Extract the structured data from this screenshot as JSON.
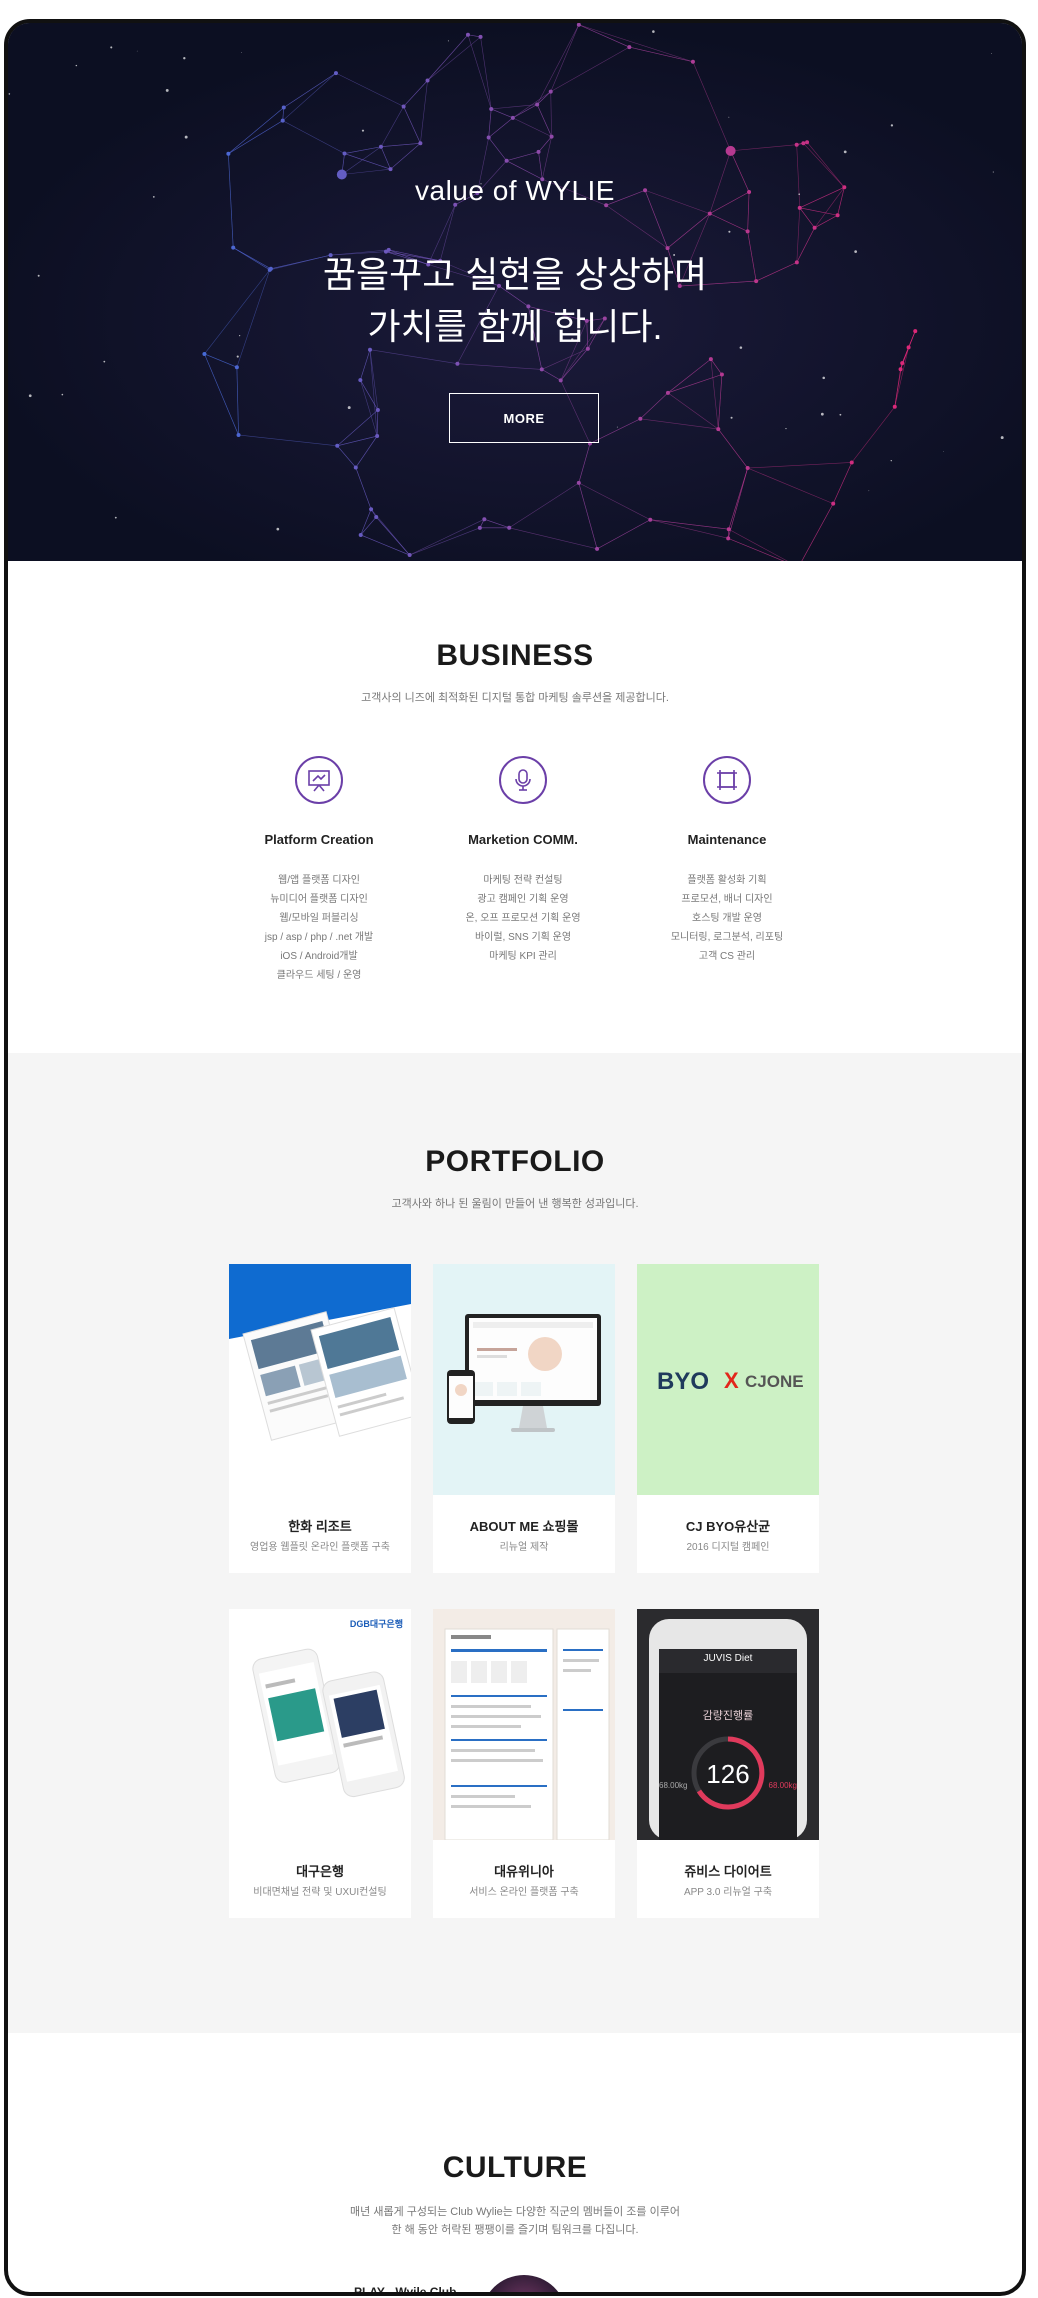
{
  "hero": {
    "tagline": "value of WYLIE",
    "headline_line1": "꿈을꾸고 실현을 상상하며",
    "headline_line2": "가치를 함께 합니다.",
    "more_label": "MORE"
  },
  "business": {
    "title": "BUSINESS",
    "subtitle": "고객사의 니즈에 최적화된 디지털 통합 마케팅 솔루션을 제공합니다.",
    "columns": [
      {
        "icon": "presentation-board-icon",
        "name": "Platform Creation",
        "items": [
          "웹/앱 플랫폼 디자인",
          "뉴미디어 플랫폼 디자인",
          "웹/모바일 퍼블리싱",
          "jsp / asp / php / .net 개발",
          "iOS / Android개발",
          "클라우드 세팅 / 운영"
        ]
      },
      {
        "icon": "microphone-icon",
        "name": "Marketion COMM.",
        "items": [
          "마케팅 전략 컨설팅",
          "광고 캠페인 기획 운영",
          "온, 오프 프로모션 기획 운영",
          "바이럴, SNS 기획 운영",
          "마케팅 KPI 관리"
        ]
      },
      {
        "icon": "frame-grid-icon",
        "name": "Maintenance",
        "items": [
          "플랫폼 활성화 기획",
          "프로모션, 배너 디자인",
          "호스팅 개발 운영",
          "모니터링, 로그분석, 리포팅",
          "고객 CS 관리"
        ]
      }
    ]
  },
  "portfolio": {
    "title": "PORTFOLIO",
    "subtitle": "고객사와 하나 된 울림이 만들어 낸 행복한 성과입니다.",
    "items": [
      {
        "name": "한화 리조트",
        "desc": "영업용 웹플릿 온라인 플랫폼 구축"
      },
      {
        "name": "ABOUT ME 쇼핑몰",
        "desc": "리뉴얼 제작"
      },
      {
        "name": "CJ BYO유산균",
        "desc": "2016 디지털 캠페인",
        "thumb_text_left": "BYO",
        "thumb_text_right": "CJONE",
        "thumb_x": "X"
      },
      {
        "name": "대구은행",
        "desc": "비대면채널 전략 및 UXUI컨설팅",
        "thumb_brand": "DGB대구은행"
      },
      {
        "name": "대유위니아",
        "desc": "서비스 온라인 플랫폼 구축"
      },
      {
        "name": "쥬비스 다이어트",
        "desc": "APP 3.0 리뉴얼 구축",
        "thumb_app_title": "JUVIS Diet",
        "thumb_app_heading": "감량진행률",
        "thumb_app_value": "126",
        "thumb_app_left": "68.00kg",
        "thumb_app_right": "68.00kg"
      }
    ]
  },
  "culture": {
    "title": "CULTURE",
    "subtitle_line1": "매년 새롭게 구성되는 Club Wylie는 다양한 직군의 멤버들이 조를 이루어",
    "subtitle_line2": "한 해 동안 허락된 팽팽이를 즐기며 팀워크를 다집니다.",
    "play_label": "PLAY - Wyile Club"
  },
  "colors": {
    "hero_bg": "#0c0f22",
    "accent_purple": "#6b3fa8",
    "portfolio_bg": "#f5f5f5"
  }
}
